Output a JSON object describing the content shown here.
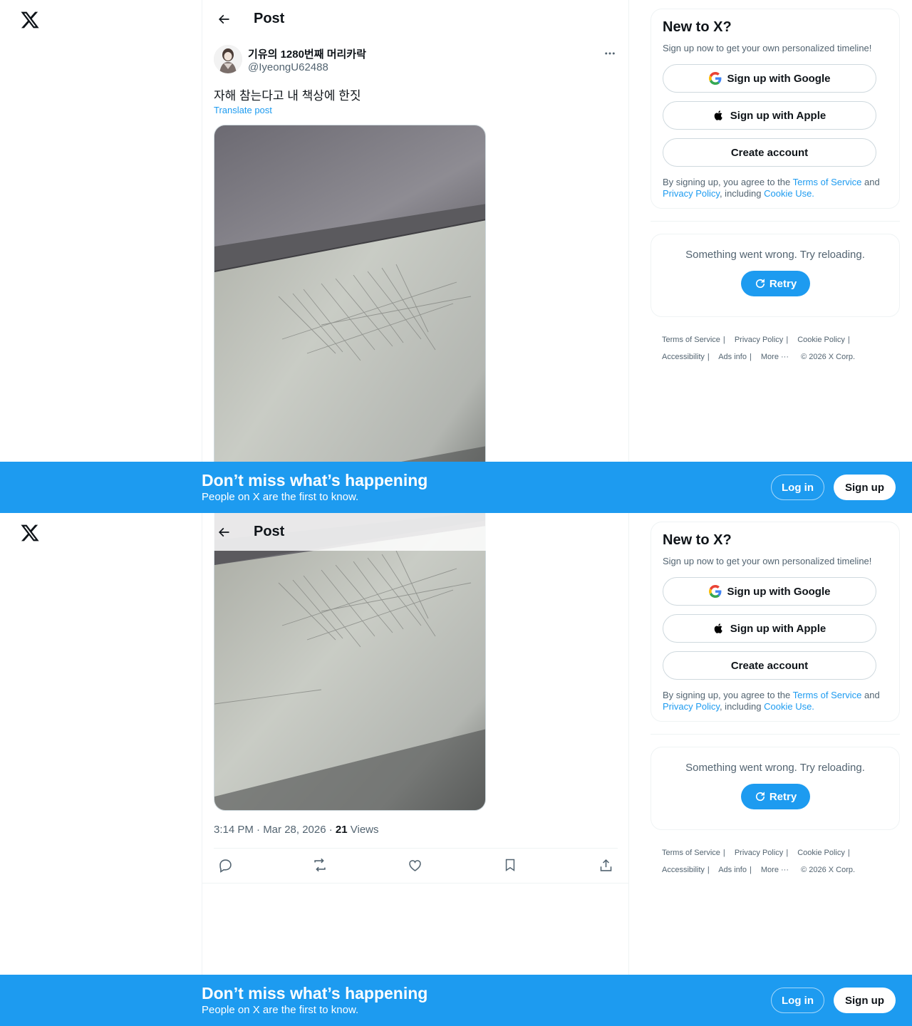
{
  "header": {
    "title": "Post"
  },
  "post": {
    "author_name": "기유의 1280번째 머리카락",
    "author_handle": "@IyeongU62488",
    "text": "자해 참는다고 내 책상에 한짓",
    "translate_label": "Translate post",
    "time": "3:14 PM · Mar 28, 2026 · ",
    "views_count": "21",
    "views_label": " Views"
  },
  "signup_card": {
    "title": "New to X?",
    "subtitle": "Sign up now to get your own personalized timeline!",
    "google_label": "Sign up with Google",
    "apple_label": "Sign up with Apple",
    "create_label": "Create account",
    "legal_prefix": "By signing up, you agree to the ",
    "terms_link": "Terms of Service",
    "legal_and": " and ",
    "privacy_link": "Privacy Policy",
    "legal_including": ", including ",
    "cookie_link": "Cookie Use."
  },
  "error_card": {
    "message": "Something went wrong. Try reloading.",
    "retry_label": "Retry"
  },
  "footer": {
    "terms": "Terms of Service",
    "privacy": "Privacy Policy",
    "cookie": "Cookie Policy",
    "accessibility": "Accessibility",
    "ads": "Ads info",
    "more": "More ···",
    "copyright": "© 2026 X Corp."
  },
  "banner": {
    "title": "Don’t miss what’s happening",
    "subtitle": "People on X are the first to know.",
    "login_label": "Log in",
    "signup_label": "Sign up"
  },
  "icons": {
    "x_logo": "x-logo-icon",
    "back": "arrow-left-icon",
    "more": "ellipsis-icon",
    "google": "google-icon",
    "apple": "apple-icon",
    "retry": "refresh-icon",
    "reply": "reply-icon",
    "repost": "repost-icon",
    "like": "heart-icon",
    "bookmark": "bookmark-icon",
    "share": "share-icon"
  },
  "colors": {
    "accent": "#1d9bf0",
    "text_primary": "#0f1419",
    "text_secondary": "#536471",
    "border": "#cfd9de"
  }
}
